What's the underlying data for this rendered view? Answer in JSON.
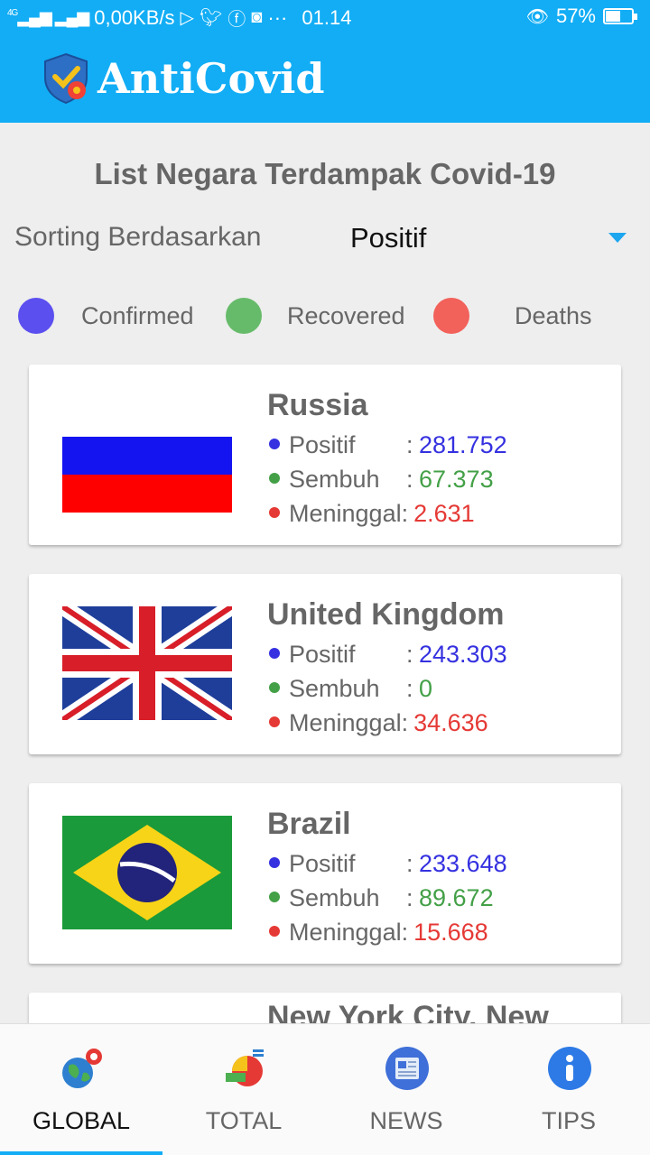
{
  "status_bar": {
    "network": "4G",
    "speed": "0,00KB/s",
    "dots": "···",
    "time": "01.14",
    "battery_text": "57%",
    "battery_level": 0.57
  },
  "app": {
    "title": "AntiCovid"
  },
  "page": {
    "title": "List Negara Terdampak Covid-19",
    "sort_label": "Sorting Berdasarkan",
    "sort_value": "Positif"
  },
  "legend": [
    {
      "label": "Confirmed",
      "color": "#5b4ff0"
    },
    {
      "label": "Recovered",
      "color": "#66bb6a"
    },
    {
      "label": "Deaths",
      "color": "#f2615a"
    }
  ],
  "colors": {
    "primary": "#12adf5",
    "positive": "#3531e0",
    "recovered": "#43a047",
    "deaths": "#e53935"
  },
  "countries": [
    {
      "name": "Russia",
      "flag": "russia-flag",
      "positive_label": "Positif",
      "positive": "281.752",
      "recovered_label": "Sembuh",
      "recovered": "67.373",
      "deaths_label": "Meninggal",
      "deaths": "2.631"
    },
    {
      "name": "United Kingdom",
      "flag": "uk-flag",
      "positive_label": "Positif",
      "positive": "243.303",
      "recovered_label": "Sembuh",
      "recovered": "0",
      "deaths_label": "Meninggal",
      "deaths": "34.636"
    },
    {
      "name": "Brazil",
      "flag": "brazil-flag",
      "positive_label": "Positif",
      "positive": "233.648",
      "recovered_label": "Sembuh",
      "recovered": "89.672",
      "deaths_label": "Meninggal",
      "deaths": "15.668"
    },
    {
      "name": "New York City, New",
      "flag": "",
      "positive_label": "",
      "positive": "",
      "recovered_label": "",
      "recovered": "",
      "deaths_label": "",
      "deaths": ""
    }
  ],
  "bottom_nav": [
    {
      "label": "GLOBAL",
      "icon": "globe-virus-icon",
      "active": true
    },
    {
      "label": "TOTAL",
      "icon": "chart-icon",
      "active": false
    },
    {
      "label": "NEWS",
      "icon": "newspaper-icon",
      "active": false
    },
    {
      "label": "TIPS",
      "icon": "info-icon",
      "active": false
    }
  ]
}
